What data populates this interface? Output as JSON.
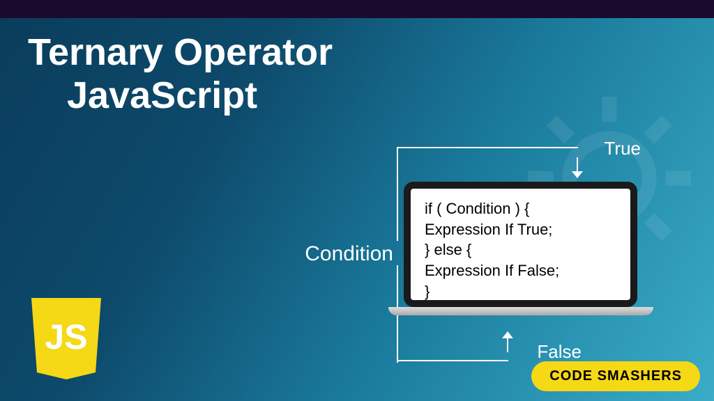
{
  "title_line1": "Ternary Operator",
  "title_line2": "JavaScript",
  "labels": {
    "condition": "Condition",
    "true": "True",
    "false": "False"
  },
  "code": {
    "line1": "if ( Condition ) {",
    "line2": "Expression If True;",
    "line3": "} else {",
    "line4": "Expression If False;",
    "line5": "}"
  },
  "badge": "CODE SMASHERS",
  "js_logo_text": "JS",
  "colors": {
    "logo_bg": "#f5d816",
    "badge_bg": "#f5d816"
  }
}
